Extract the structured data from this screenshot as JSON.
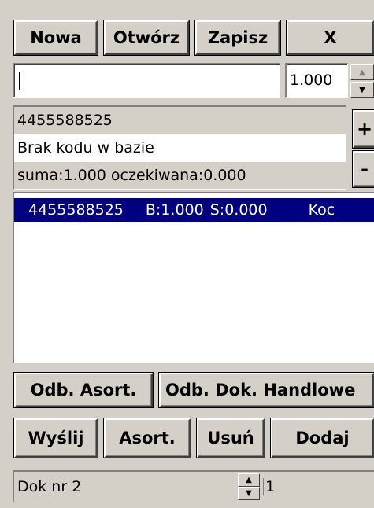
{
  "toolbar": {
    "new_label": "Nowa",
    "open_label": "Otwórz",
    "save_label": "Zapisz",
    "close_label": "X"
  },
  "entry": {
    "code_value": "",
    "quantity_value": "1.000",
    "plus_label": "+",
    "minus_label": "-"
  },
  "info": {
    "code": "4455588525",
    "message": "Brak kodu w bazie",
    "summary": "suma:1.000 oczekiwana:0.000"
  },
  "list": {
    "rows": [
      {
        "code": "4455588525",
        "b": "B:1.000",
        "s": "S:0.000",
        "extra": "Koc"
      }
    ]
  },
  "selectors": {
    "assort_label": "Odb. Asort.",
    "docs_label": "Odb. Dok. Handlowe"
  },
  "actions": {
    "send_label": "Wyślij",
    "assort_label": "Asort.",
    "delete_label": "Usuń",
    "add_label": "Dodaj"
  },
  "status": {
    "document": "Dok nr 2",
    "page": "1"
  },
  "colors": {
    "selection": "#000080",
    "face": "#d4d0c8"
  }
}
